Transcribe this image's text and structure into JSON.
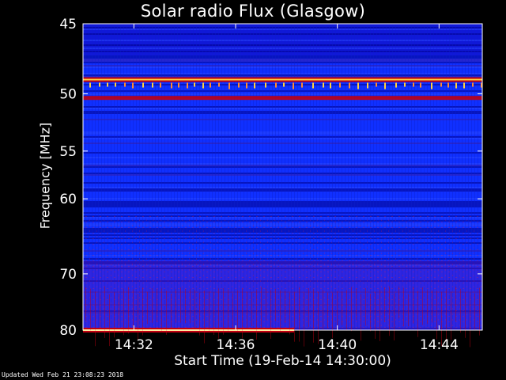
{
  "chart_data": {
    "type": "heatmap",
    "title": "Solar radio Flux (Glasgow)",
    "xlabel": "Start Time (19-Feb-14 14:30:00)",
    "ylabel": "Frequency [MHz]",
    "x_unit": "minutes past 14:30:00",
    "xlim": [
      0,
      15.7
    ],
    "ylim": [
      80,
      45
    ],
    "y_scale": "reciprocal",
    "x_ticks": [
      {
        "value": 2,
        "label": "14:32"
      },
      {
        "value": 6,
        "label": "14:36"
      },
      {
        "value": 10,
        "label": "14:40"
      },
      {
        "value": 14,
        "label": "14:44"
      }
    ],
    "y_ticks": [
      {
        "value": 45,
        "label": "45"
      },
      {
        "value": 50,
        "label": "50"
      },
      {
        "value": 55,
        "label": "55"
      },
      {
        "value": 60,
        "label": "60"
      },
      {
        "value": 70,
        "label": "70"
      },
      {
        "value": 80,
        "label": "80"
      }
    ],
    "colormap": [
      "#00008c",
      "#1030ff",
      "#c00010",
      "#ffd040"
    ],
    "features": [
      {
        "name": "interference line",
        "frequency": 48.9,
        "x_range": [
          0,
          15.7
        ],
        "intensity": "high"
      },
      {
        "name": "interference line",
        "frequency": 50.3,
        "x_range": [
          0,
          15.7
        ],
        "intensity": "medium"
      },
      {
        "name": "interference line",
        "frequency": 80.0,
        "x_range": [
          0,
          8.3
        ],
        "intensity": "high"
      }
    ],
    "grid": false
  },
  "footer": "Updated Wed Feb 21 23:08:23 2018"
}
